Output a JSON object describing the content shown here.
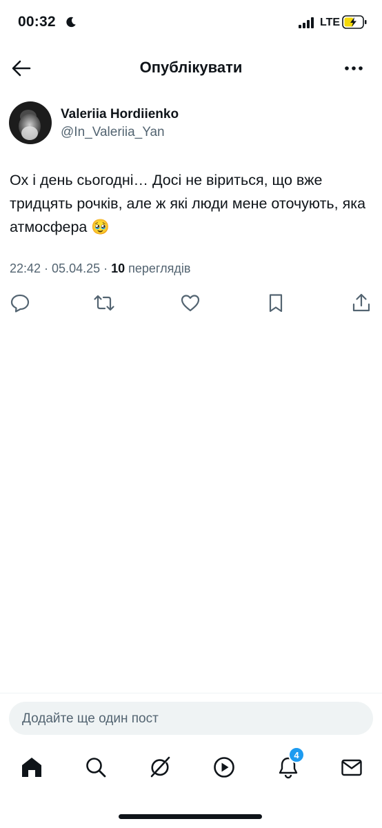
{
  "status_bar": {
    "time": "00:32",
    "network": "LTE",
    "icons": [
      "moon-icon",
      "signal-icon",
      "battery-charging-icon"
    ]
  },
  "header": {
    "title": "Опублікувати",
    "icons": [
      "back-arrow-icon",
      "more-dots-icon"
    ]
  },
  "author": {
    "name": "Valeriia Hordiienko",
    "handle": "@In_Valeriia_Yan"
  },
  "post": {
    "text": "Ох і день сьогодні… Досі не віриться, що вже тридцять рочків, але ж які люди мене оточують, яка атмосфера 🥹",
    "timestamp": "22:42 · 05.04.25 · ",
    "views_count": "10",
    "views_label": " переглядів"
  },
  "actions": {
    "icons": [
      "reply-icon",
      "repost-icon",
      "like-icon",
      "bookmark-icon",
      "share-icon"
    ]
  },
  "composer": {
    "placeholder": "Додайте ще один пост"
  },
  "tabbar": {
    "icons": [
      "home-icon",
      "search-icon",
      "grok-icon",
      "video-icon",
      "notifications-icon",
      "messages-icon"
    ],
    "notifications_badge": "4"
  },
  "colors": {
    "text": "#0f1419",
    "secondary": "#536471",
    "accent": "#1d9bf0",
    "battery": "#f5d90a"
  }
}
